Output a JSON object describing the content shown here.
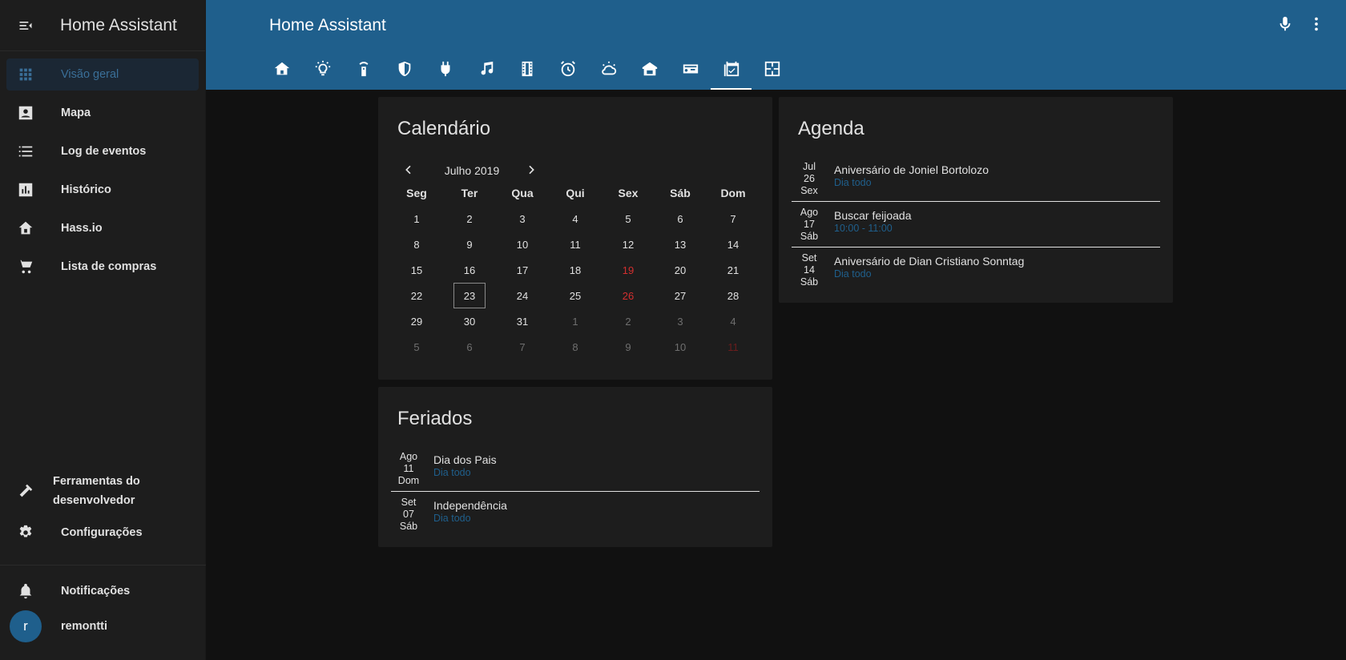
{
  "sidebar": {
    "title": "Home Assistant",
    "items": [
      {
        "label": "Visão geral",
        "icon": "apps-icon"
      },
      {
        "label": "Mapa",
        "icon": "map-icon"
      },
      {
        "label": "Log de eventos",
        "icon": "list-icon"
      },
      {
        "label": "Histórico",
        "icon": "chart-icon"
      },
      {
        "label": "Hass.io",
        "icon": "hassio-icon"
      },
      {
        "label": "Lista de compras",
        "icon": "cart-icon"
      }
    ],
    "dev_tools": {
      "line1": "Ferramentas do",
      "line2": "desenvolvedor"
    },
    "settings": "Configurações",
    "notifications": "Notificações",
    "user": {
      "initial": "r",
      "name": "remontti"
    }
  },
  "header": {
    "title": "Home Assistant",
    "tabs": [
      "home-icon",
      "lightbulb-icon",
      "remote-icon",
      "shield-icon",
      "plug-icon",
      "music-icon",
      "film-icon",
      "alarm-icon",
      "weather-icon",
      "house-icon",
      "projector-icon",
      "calendar-check-icon",
      "floorplan-icon"
    ],
    "active_tab": 11
  },
  "calendar_card": {
    "title": "Calendário",
    "month": "Julho 2019",
    "weekdays": [
      "Seg",
      "Ter",
      "Qua",
      "Qui",
      "Sex",
      "Sáb",
      "Dom"
    ],
    "weeks": [
      [
        {
          "d": "1"
        },
        {
          "d": "2"
        },
        {
          "d": "3"
        },
        {
          "d": "4"
        },
        {
          "d": "5"
        },
        {
          "d": "6"
        },
        {
          "d": "7"
        }
      ],
      [
        {
          "d": "8"
        },
        {
          "d": "9"
        },
        {
          "d": "10"
        },
        {
          "d": "11"
        },
        {
          "d": "12"
        },
        {
          "d": "13"
        },
        {
          "d": "14"
        }
      ],
      [
        {
          "d": "15"
        },
        {
          "d": "16"
        },
        {
          "d": "17"
        },
        {
          "d": "18"
        },
        {
          "d": "19",
          "holiday": true
        },
        {
          "d": "20"
        },
        {
          "d": "21"
        }
      ],
      [
        {
          "d": "22"
        },
        {
          "d": "23",
          "today": true
        },
        {
          "d": "24"
        },
        {
          "d": "25"
        },
        {
          "d": "26",
          "holiday": true
        },
        {
          "d": "27"
        },
        {
          "d": "28"
        }
      ],
      [
        {
          "d": "29"
        },
        {
          "d": "30"
        },
        {
          "d": "31"
        },
        {
          "d": "1",
          "other": true
        },
        {
          "d": "2",
          "other": true
        },
        {
          "d": "3",
          "other": true
        },
        {
          "d": "4",
          "other": true
        }
      ],
      [
        {
          "d": "5",
          "other": true
        },
        {
          "d": "6",
          "other": true
        },
        {
          "d": "7",
          "other": true
        },
        {
          "d": "8",
          "other": true
        },
        {
          "d": "9",
          "other": true
        },
        {
          "d": "10",
          "other": true
        },
        {
          "d": "11",
          "other": true,
          "holiday": true
        }
      ]
    ]
  },
  "holidays_card": {
    "title": "Feriados",
    "events": [
      {
        "month": "Ago",
        "day": "11",
        "weekday": "Dom",
        "title": "Dia dos Pais",
        "time": "Dia todo"
      },
      {
        "month": "Set",
        "day": "07",
        "weekday": "Sáb",
        "title": "Independência",
        "time": "Dia todo"
      }
    ]
  },
  "agenda_card": {
    "title": "Agenda",
    "events": [
      {
        "month": "Jul",
        "day": "26",
        "weekday": "Sex",
        "title": "Aniversário de Joniel Bortolozo",
        "time": "Dia todo"
      },
      {
        "month": "Ago",
        "day": "17",
        "weekday": "Sáb",
        "title": "Buscar feijoada",
        "time": "10:00 - 11:00"
      },
      {
        "month": "Set",
        "day": "14",
        "weekday": "Sáb",
        "title": "Aniversário de Dian Cristiano Sonntag",
        "time": "Dia todo"
      }
    ]
  },
  "colors": {
    "accent": "#1f5f8c",
    "background": "#111111",
    "card": "#1d1d1d",
    "holiday": "#d32f2f"
  }
}
